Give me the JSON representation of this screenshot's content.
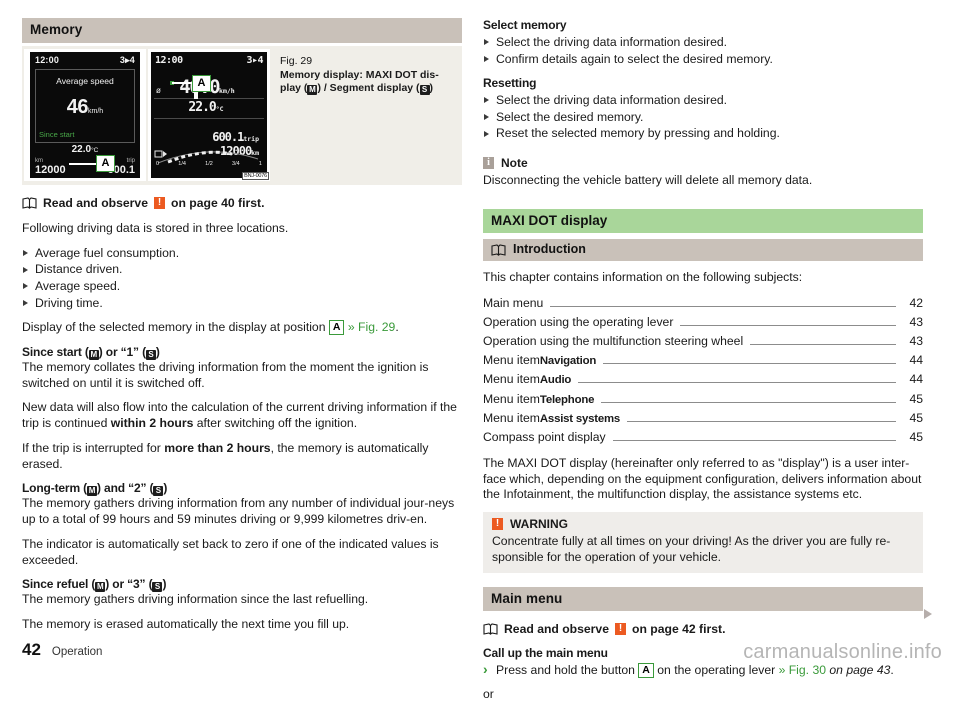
{
  "left": {
    "section_header": "Memory",
    "figure": {
      "caption_number": "Fig. 29",
      "caption_title_line1": "Memory display: MAXI DOT dis-",
      "caption_title_line2_pre": "play (",
      "caption_m": "M",
      "caption_mid": ") / Segment display (",
      "caption_s": "S",
      "caption_end": ")",
      "dot_display": {
        "clock": "12:00",
        "gear": "3▸4",
        "title": "Average speed",
        "value": "46",
        "unit": "km/h",
        "memory_label": "Since start",
        "temp": "22.0",
        "temp_unit": "°C",
        "odo_label_left": "km",
        "odo_label_right": "trip",
        "odo_value": "12000",
        "trip_value": "600.1",
        "callout": "A"
      },
      "segment_display": {
        "clock": "12:00",
        "gear": "3▸4",
        "avg_symbol": "ø",
        "value": "46.0",
        "unit": "km/h",
        "temp": "22.0",
        "temp_unit": "°C",
        "trip_value": "600.1",
        "trip_unit": "trip",
        "odo_value": "12000",
        "odo_unit": "km",
        "fuel_ticks": [
          "0",
          "1/4",
          "1/2",
          "3/4",
          "1"
        ],
        "image_code": "BNJ-0076",
        "callout": "A"
      }
    },
    "read_observe": {
      "pre": "Read and observe",
      "warn_glyph": "!",
      "post": "on page 40 first."
    },
    "intro": "Following driving data is stored in three locations.",
    "bullets": [
      "Average fuel consumption.",
      "Distance driven.",
      "Average speed.",
      "Driving time."
    ],
    "display_position": {
      "pre": "Display of the selected memory in the display at position",
      "box": "A",
      "link": "» Fig. 29",
      "end": "."
    },
    "blocks": [
      {
        "heading_parts": [
          "Since start (",
          "M",
          ") or “1” (",
          "S",
          ")"
        ],
        "paragraphs": [
          "The memory collates the driving information from the moment the ignition is switched on until it is switched off."
        ]
      },
      {
        "heading_parts": [
          "Long-term (",
          "M",
          ") and “2” (",
          "S",
          ")"
        ],
        "paragraphs": [
          "The memory gathers driving information from any number of individual jour-neys up to a total of 99 hours and 59 minutes driving or 9,999 kilometres driv-en."
        ]
      },
      {
        "heading_parts": [
          "Since refuel (",
          "M",
          ") or “3” (",
          "S",
          ")"
        ],
        "paragraphs": [
          "The memory gathers driving information since the last refuelling."
        ]
      }
    ],
    "para_new_data_pre": "New data will also flow into the calculation of the current driving information if the trip is continued ",
    "para_new_data_bold": "within 2 hours",
    "para_new_data_post": " after switching off the ignition.",
    "para_interrupt_pre": "If the trip is interrupted for ",
    "para_interrupt_bold": "more than 2 hours",
    "para_interrupt_post": ", the memory is automatically erased.",
    "para_indicator": "The indicator is automatically set back to zero if one of the indicated values is exceeded.",
    "para_erased": "The memory is erased automatically the next time you fill up."
  },
  "right": {
    "select_memory_heading": "Select memory",
    "select_memory_bullets": [
      "Select the driving data information desired.",
      "Confirm details again to select the desired memory."
    ],
    "resetting_heading": "Resetting",
    "resetting_bullets": [
      "Select the driving data information desired.",
      "Select the desired memory.",
      "Reset the selected memory by pressing and holding."
    ],
    "note": {
      "title": "Note",
      "glyph": "i",
      "body": "Disconnecting the vehicle battery will delete all memory data."
    },
    "section_header_green": "MAXI DOT display",
    "introduction_header": "Introduction",
    "intro_line": "This chapter contains information on the following subjects:",
    "toc": [
      {
        "label": "Main menu",
        "strong": "",
        "page": "42"
      },
      {
        "label": "Operation using the operating lever",
        "strong": "",
        "page": "43"
      },
      {
        "label": "Operation using the multifunction steering wheel",
        "strong": "",
        "page": "43"
      },
      {
        "label": "Menu item",
        "strong": "Navigation",
        "page": "44"
      },
      {
        "label": "Menu item",
        "strong": "Audio",
        "page": "44"
      },
      {
        "label": "Menu item",
        "strong": "Telephone",
        "page": "45"
      },
      {
        "label": "Menu item",
        "strong": "Assist systems",
        "page": "45"
      },
      {
        "label": "Compass point display",
        "strong": "",
        "page": "45"
      }
    ],
    "maxi_paragraph": "The MAXI DOT display (hereinafter only referred to as \"display\") is a user inter-face which, depending on the equipment configuration, delivers information about the Infotainment, the multifunction display, the assistance systems etc.",
    "warning": {
      "title": "WARNING",
      "glyph": "!",
      "body": "Concentrate fully at all times on your driving! As the driver you are fully re-sponsible for the operation of your vehicle."
    },
    "main_menu_header": "Main menu",
    "read_observe": {
      "pre": "Read and observe",
      "warn_glyph": "!",
      "post": "on page 42 first."
    },
    "call_up_heading": "Call up the main menu",
    "call_up_item": {
      "pre": "Press and hold the button",
      "box": "A",
      "mid": "on the operating lever",
      "link": "» Fig. 30",
      "italic": "on page 43",
      "end": "."
    },
    "or_text": "or"
  },
  "footer": {
    "page_number": "42",
    "section": "Operation",
    "watermark": "carmanualsonline.info"
  },
  "colors": {
    "header_gray": "#c9c1b9",
    "header_green": "#a9d69a",
    "accent_green": "#3a9a3a",
    "warning_orange": "#ec5a21",
    "note_gray": "#a9a099",
    "callout_bg": "#efedea",
    "figure_bg": "#f0eee8"
  }
}
